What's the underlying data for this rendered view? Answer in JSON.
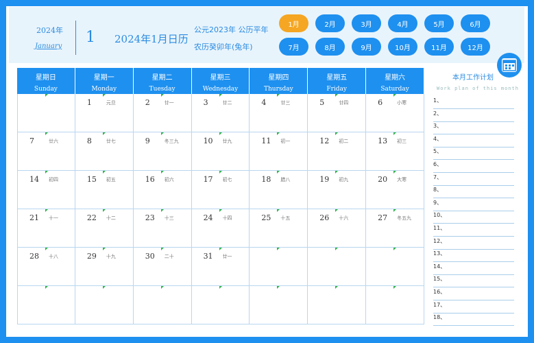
{
  "header": {
    "year": "2024年",
    "month_en": "January",
    "month_num": "1",
    "title": "2024年1月日历",
    "line1": "公元2023年 公历平年",
    "line2": "农历癸卯年(兔年)"
  },
  "months": [
    "1月",
    "2月",
    "3月",
    "4月",
    "5月",
    "6月",
    "7月",
    "8月",
    "9月",
    "10月",
    "11月",
    "12月"
  ],
  "active_month_index": 0,
  "weekdays": [
    {
      "cn": "星期日",
      "en": "Sunday"
    },
    {
      "cn": "星期一",
      "en": "Monday"
    },
    {
      "cn": "星期二",
      "en": "Tuesday"
    },
    {
      "cn": "星期三",
      "en": "Wednesday"
    },
    {
      "cn": "星期四",
      "en": "Thursday"
    },
    {
      "cn": "星期五",
      "en": "Friday"
    },
    {
      "cn": "星期六",
      "en": "Saturday"
    }
  ],
  "days": [
    {
      "n": "1",
      "l": "元旦"
    },
    {
      "n": "2",
      "l": "廿一"
    },
    {
      "n": "3",
      "l": "廿二"
    },
    {
      "n": "4",
      "l": "廿三"
    },
    {
      "n": "5",
      "l": "廿四"
    },
    {
      "n": "6",
      "l": "小寒"
    },
    {
      "n": "7",
      "l": "廿六"
    },
    {
      "n": "8",
      "l": "廿七"
    },
    {
      "n": "9",
      "l": "冬三九"
    },
    {
      "n": "10",
      "l": "廿九"
    },
    {
      "n": "11",
      "l": "初一"
    },
    {
      "n": "12",
      "l": "初二"
    },
    {
      "n": "13",
      "l": "初三"
    },
    {
      "n": "14",
      "l": "初四"
    },
    {
      "n": "15",
      "l": "初五"
    },
    {
      "n": "16",
      "l": "初六"
    },
    {
      "n": "17",
      "l": "初七"
    },
    {
      "n": "18",
      "l": "腊八"
    },
    {
      "n": "19",
      "l": "初九"
    },
    {
      "n": "20",
      "l": "大寒"
    },
    {
      "n": "21",
      "l": "十一"
    },
    {
      "n": "22",
      "l": "十二"
    },
    {
      "n": "23",
      "l": "十三"
    },
    {
      "n": "24",
      "l": "十四"
    },
    {
      "n": "25",
      "l": "十五"
    },
    {
      "n": "26",
      "l": "十六"
    },
    {
      "n": "27",
      "l": "冬五九"
    },
    {
      "n": "28",
      "l": "十八"
    },
    {
      "n": "29",
      "l": "十九"
    },
    {
      "n": "30",
      "l": "二十"
    },
    {
      "n": "31",
      "l": "廿一"
    }
  ],
  "first_weekday": 1,
  "plan": {
    "title": "本月工作计划",
    "subtitle": "Work plan of this month",
    "items": [
      "1、",
      "2、",
      "3、",
      "4、",
      "5、",
      "6、",
      "7、",
      "8、",
      "9、",
      "10、",
      "11、",
      "12、",
      "13、",
      "14、",
      "15、",
      "16、",
      "17、",
      "18、"
    ]
  },
  "colors": {
    "primary": "#1e90ef",
    "accent": "#f5a623"
  }
}
